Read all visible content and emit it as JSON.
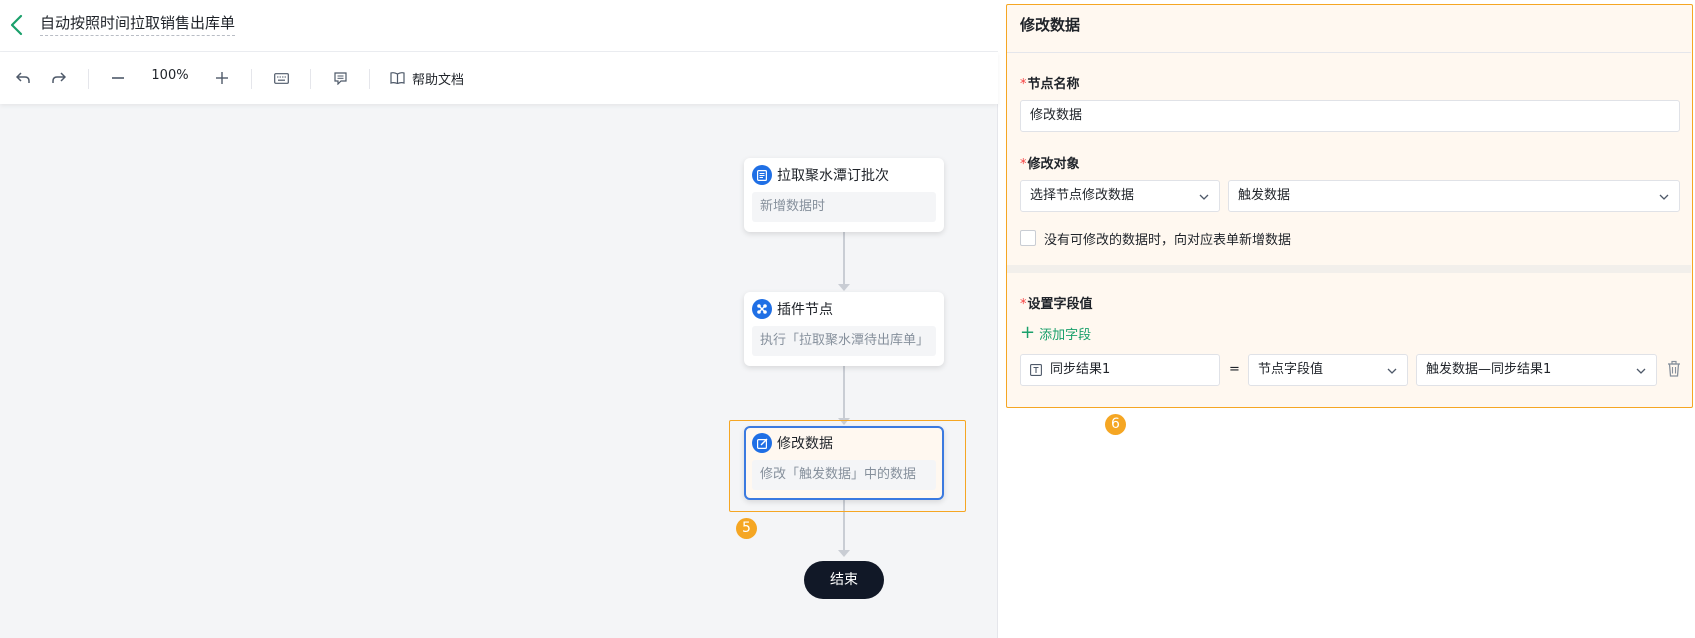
{
  "header": {
    "title": "自动按照时间拉取销售出库单"
  },
  "toolbar": {
    "zoom": "100%",
    "help_label": "帮助文档"
  },
  "flow": {
    "nodes": [
      {
        "title": "拉取聚水潭订批次",
        "body": "新增数据时",
        "icon": "list-icon"
      },
      {
        "title": "插件节点",
        "body": "执行「拉取聚水潭待出库单」",
        "icon": "plugin-icon"
      },
      {
        "title": "修改数据",
        "body": "修改「触发数据」中的数据",
        "icon": "edit-icon"
      }
    ],
    "end_label": "结束",
    "badge_left": "5"
  },
  "panel": {
    "title": "修改数据",
    "badge": "6",
    "node_name_label": "节点名称",
    "node_name_value": "修改数据",
    "target_label": "修改对象",
    "target_mode": "选择节点修改数据",
    "target_source": "触发数据",
    "checkbox_label": "没有可修改的数据时，向对应表单新增数据",
    "set_values_label": "设置字段值",
    "add_field_label": "添加字段",
    "field_row": {
      "field": "同步结果1",
      "operator": "=",
      "value_type": "节点字段值",
      "value": "触发数据—同步结果1"
    }
  },
  "colors": {
    "highlight": "#f5a623",
    "primary": "#1f6fe5",
    "accent_green": "#1aa06b",
    "required": "#f53f3f"
  }
}
